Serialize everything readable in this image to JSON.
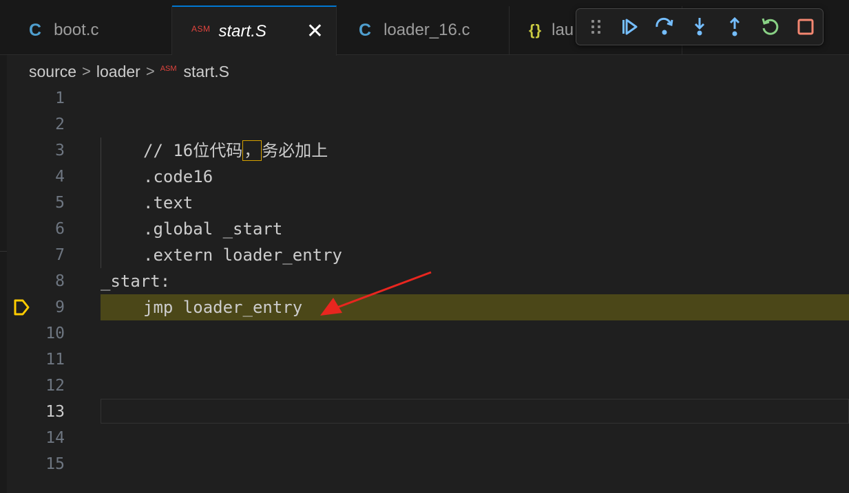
{
  "tabs": [
    {
      "icon": "C",
      "label": "boot.c"
    },
    {
      "icon": "ASM",
      "label": "start.S",
      "close": "✕"
    },
    {
      "icon": "C",
      "label": "loader_16.c"
    },
    {
      "icon": "{}",
      "label": "lau"
    }
  ],
  "breadcrumb": {
    "part1": "source",
    "part2": "loader",
    "icon": "ASM",
    "file": "start.S",
    "sep": ">"
  },
  "debug_toolbar": [
    "continue-icon",
    "step-over-icon",
    "step-into-icon",
    "step-out-icon",
    "restart-icon",
    "stop-icon"
  ],
  "colors": {
    "accent": "#0078d4",
    "debug_blue": "#75beff",
    "restart_green": "#89d185",
    "stop_red": "#f48771",
    "highlight": "#4b4718",
    "arrow": "#e8261f"
  },
  "editor": {
    "line_numbers": [
      "1",
      "2",
      "3",
      "4",
      "5",
      "6",
      "7",
      "8",
      "9",
      "10",
      "11",
      "12",
      "13",
      "14",
      "15"
    ],
    "lines": {
      "l3_a": "// 16位代码",
      "l3_box": "，",
      "l3_b": "务必加上",
      "l4": ".code16",
      "l5": ".text",
      "l6": ".global _start",
      "l7": ".extern loader_entry",
      "l8": "_start:",
      "l9": "jmp loader_entry"
    },
    "current_line": 13,
    "stopped_line": 9
  }
}
